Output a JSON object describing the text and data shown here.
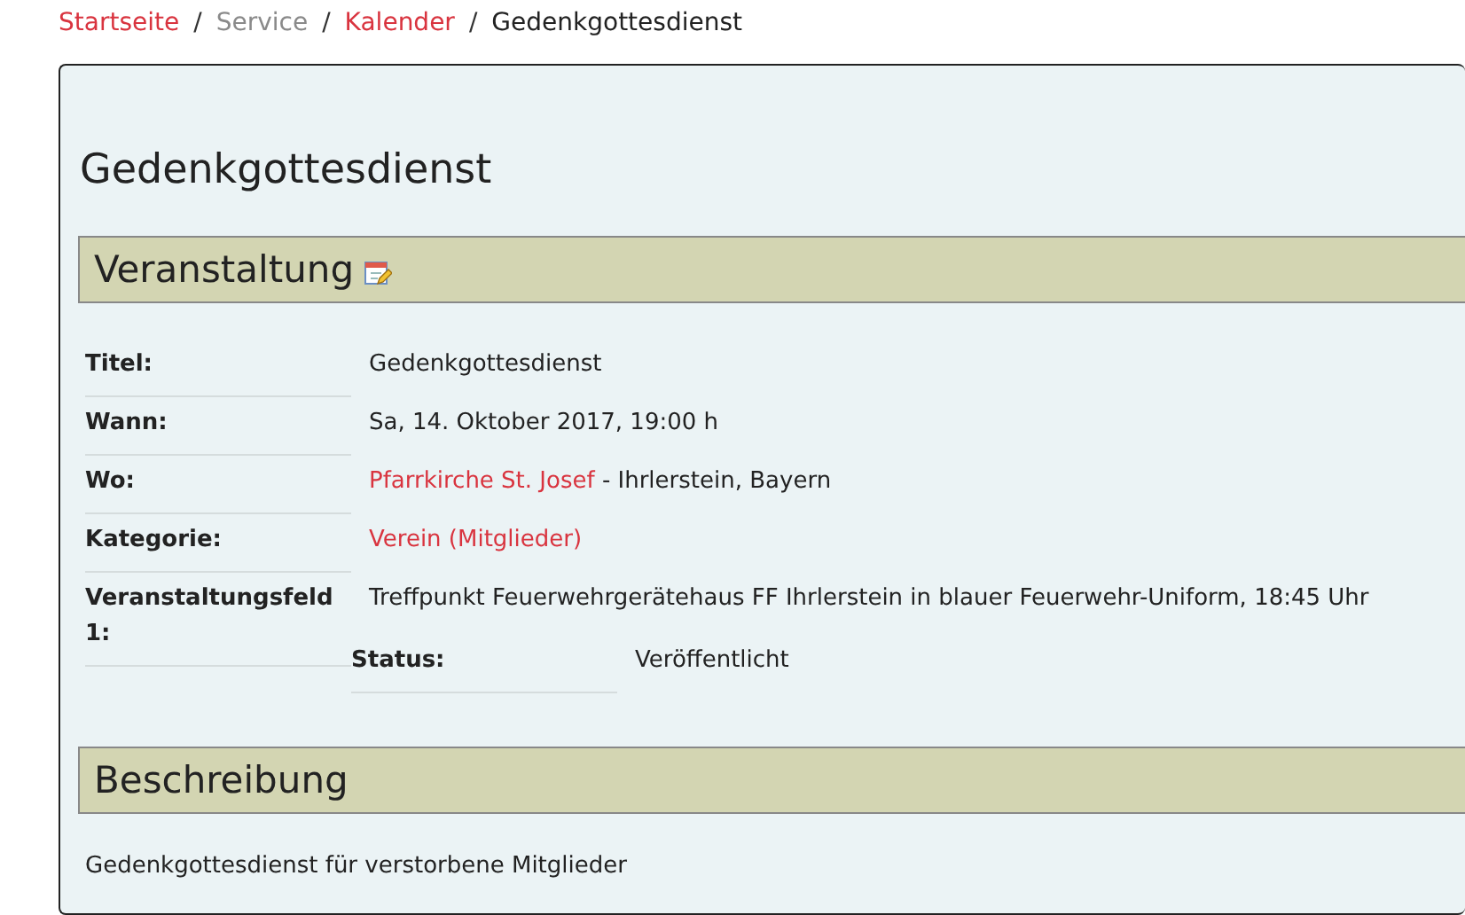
{
  "breadcrumb": [
    {
      "label": "Startseite",
      "kind": "link"
    },
    {
      "label": "Service",
      "kind": "muted"
    },
    {
      "label": "Kalender",
      "kind": "link"
    },
    {
      "label": "Gedenkgottesdienst",
      "kind": "current"
    }
  ],
  "separator": "/",
  "title": "Gedenkgottesdienst",
  "sections": [
    {
      "heading": "Veranstaltung",
      "edit_icon": true,
      "rows": [
        {
          "label": "Titel:",
          "kind": "normal",
          "value": [
            {
              "text": "Gedenkgottesdienst",
              "link": false
            }
          ]
        },
        {
          "label": "Wann:",
          "kind": "normal",
          "value": [
            {
              "text": "Sa, 14. Oktober 2017, 19:00 h",
              "link": false
            }
          ]
        },
        {
          "label": "Wo:",
          "kind": "normal",
          "value": [
            {
              "text": "Pfarrkirche St. Josef",
              "link": true
            },
            {
              "text": " - Ihrlerstein, Bayern",
              "link": false
            }
          ]
        },
        {
          "label": "Kategorie:",
          "kind": "normal",
          "value": [
            {
              "text": "Verein (Mitglieder)",
              "link": true
            }
          ]
        },
        {
          "label": "Veranstaltungsfeld 1:",
          "kind": "normal",
          "value": [
            {
              "text": "Treffpunkt Feuerwehrgerätehaus FF Ihrlerstein in blauer Feuerwehr-Uniform, 18:45 Uhr",
              "link": false
            }
          ]
        },
        {
          "label": "Status:",
          "kind": "offset",
          "value": [
            {
              "text": "Veröffentlicht",
              "link": false
            }
          ]
        }
      ]
    },
    {
      "heading": "Beschreibung",
      "text": "Gedenkgottesdienst für verstorbene Mitglieder"
    }
  ]
}
